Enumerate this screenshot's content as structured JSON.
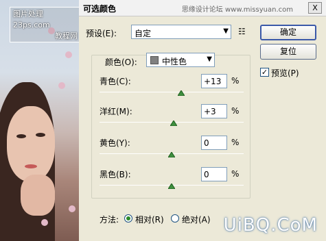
{
  "logo": {
    "line1": "图片处理",
    "line2": "23ps.com",
    "line3": "教程网"
  },
  "dialog": {
    "title": "可选颜色",
    "site": "思缘设计论坛  www.missyuan.com",
    "close_label": "X"
  },
  "preset": {
    "label": "预设(E):",
    "value": "自定"
  },
  "buttons": {
    "ok": "确定",
    "reset": "复位"
  },
  "preview": {
    "label": "预览(P)",
    "checked": true
  },
  "colors": {
    "label": "颜色(O):",
    "value": "中性色",
    "swatch_color": "#808080"
  },
  "sliders": [
    {
      "label": "青色(C):",
      "value": "+13",
      "unit": "%",
      "level": 0.565
    },
    {
      "label": "洋红(M):",
      "value": "+3",
      "unit": "%",
      "level": 0.515
    },
    {
      "label": "黄色(Y):",
      "value": "0",
      "unit": "%",
      "level": 0.5
    },
    {
      "label": "黑色(B):",
      "value": "0",
      "unit": "%",
      "level": 0.5
    }
  ],
  "method": {
    "label": "方法:",
    "relative": "相对(R)",
    "absolute": "绝对(A)",
    "selected": "relative"
  },
  "watermark": "UiBQ.CoM"
}
